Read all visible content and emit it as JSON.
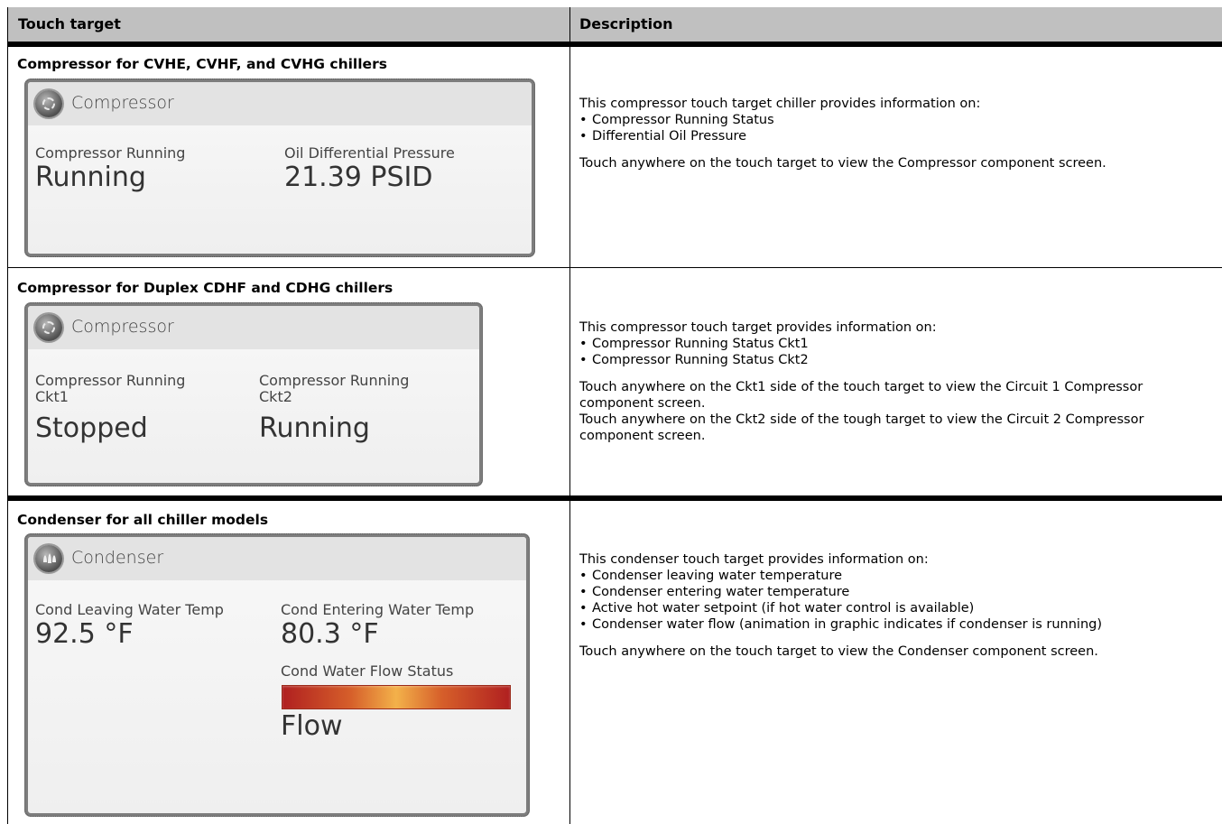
{
  "header": {
    "col1": "Touch target",
    "col2": "Description"
  },
  "rows": [
    {
      "title": "Compressor for CVHE, CVHF, and CVHG chillers",
      "widget": {
        "title": "Compressor",
        "label1": "Compressor Running",
        "value1": "Running",
        "label2": "Oil Differential Pressure",
        "value2": "21.39 PSID"
      },
      "desc_intro": "This compressor touch target chiller provides information on:",
      "bullets": [
        "Compressor Running Status",
        "Differential Oil Pressure"
      ],
      "desc_body": "Touch anywhere on the touch target to view the Compressor component screen."
    },
    {
      "title": "Compressor for Duplex CDHF and CDHG chillers",
      "widget": {
        "title": "Compressor",
        "label1a": "Compressor Running",
        "label1b": "Ckt1",
        "value1": "Stopped",
        "label2a": "Compressor Running",
        "label2b": "Ckt2",
        "value2": "Running"
      },
      "desc_intro": "This compressor touch target provides information on:",
      "bullets": [
        "Compressor Running Status Ckt1",
        "Compressor Running Status Ckt2"
      ],
      "desc_body1": "Touch anywhere on the Ckt1 side of the touch target to view the Circuit 1 Compressor component screen.",
      "desc_body2": "Touch anywhere on the Ckt2 side of the tough target to view the Circuit 2 Compressor component screen."
    },
    {
      "title": "Condenser for all chiller models",
      "widget": {
        "title": "Condenser",
        "label1": "Cond Leaving Water Temp",
        "value1": "92.5 °F",
        "label2": "Cond Entering Water Temp",
        "value2": "80.3 °F",
        "label3": "Cond Water Flow Status",
        "value3": "Flow"
      },
      "desc_intro": "This condenser touch target provides information on:",
      "bullets": [
        "Condenser leaving water temperature",
        "Condenser entering water temperature",
        "Active hot water setpoint (if hot water control is available)",
        "Condenser water flow (animation in graphic indicates if condenser is running)"
      ],
      "desc_body": "Touch anywhere on the touch target to view the Condenser component screen."
    }
  ]
}
